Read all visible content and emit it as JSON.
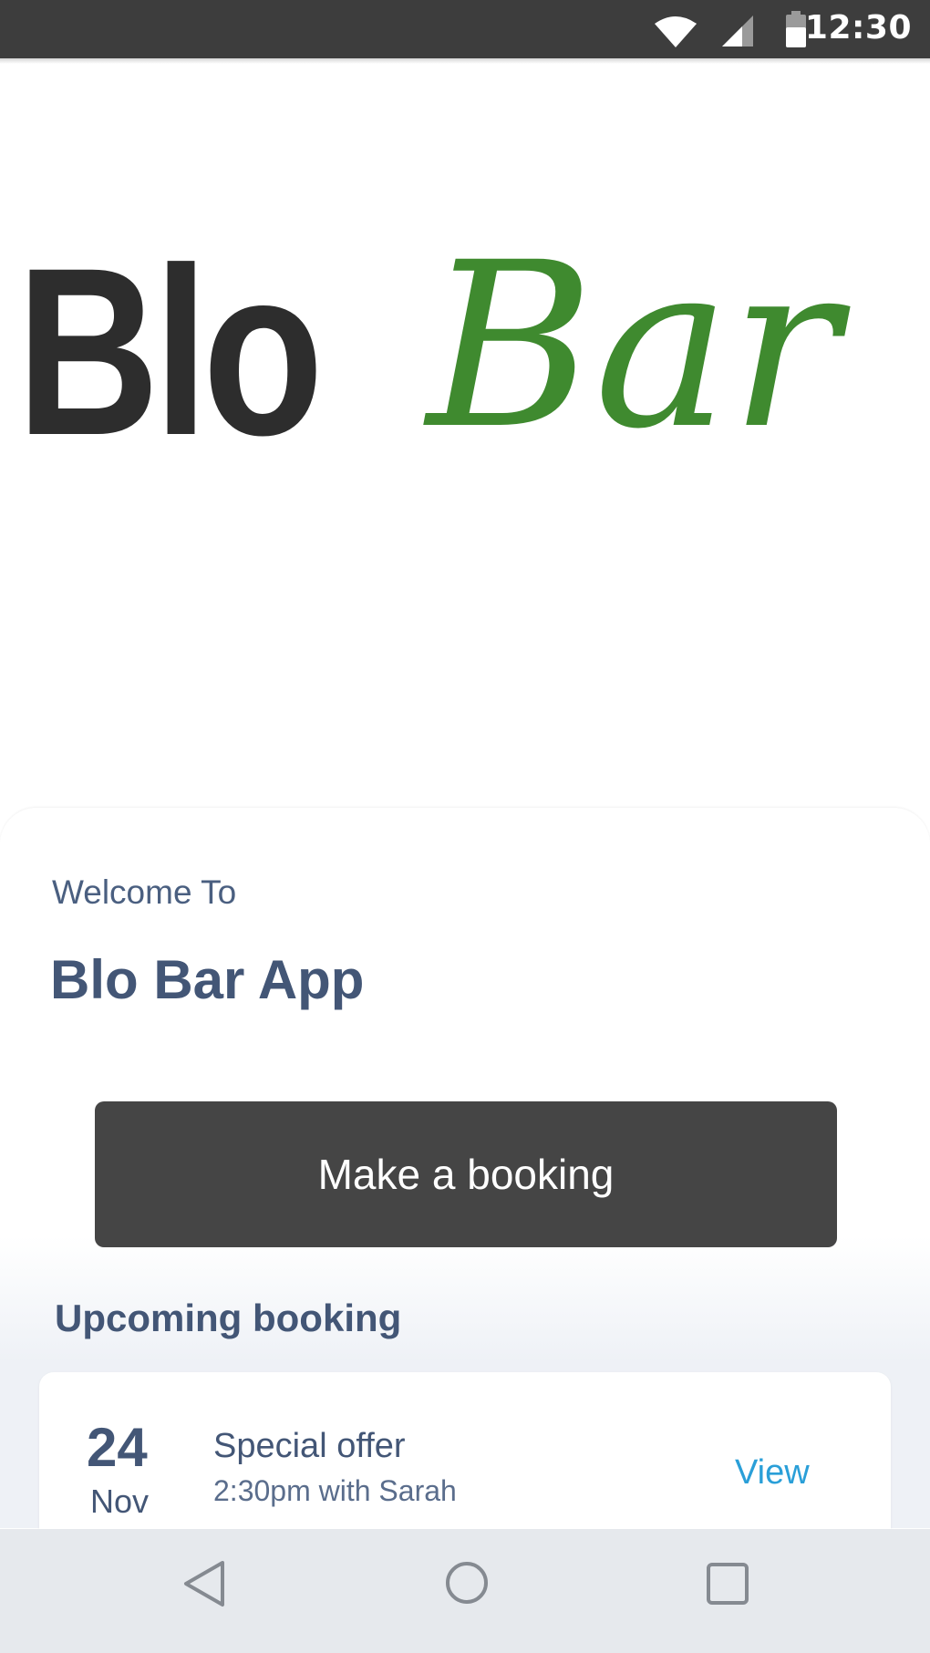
{
  "status_bar": {
    "time": "12:30",
    "icons": [
      "wifi-icon",
      "cell-signal-icon",
      "battery-icon"
    ]
  },
  "logo": {
    "bold_part": "Blo",
    "script_part": "Bar",
    "bold_color": "#2d2d2d",
    "script_color": "#3f8a2f"
  },
  "main": {
    "welcome": "Welcome To",
    "title": "Blo Bar App",
    "booking_button_label": "Make a booking",
    "upcoming_title": "Upcoming booking"
  },
  "upcoming_booking": {
    "day": "24",
    "month": "Nov",
    "title": "Special offer",
    "time": "2:30pm with Sarah",
    "action": "View"
  },
  "nav_bar": {
    "buttons": [
      "back-icon",
      "home-icon",
      "recents-icon"
    ]
  },
  "colors": {
    "text_primary": "#435676",
    "button_bg": "#454545",
    "link": "#2a9fd8",
    "status_bar_bg": "#3d3d3d",
    "nav_bar_bg": "#e6e9ed"
  }
}
